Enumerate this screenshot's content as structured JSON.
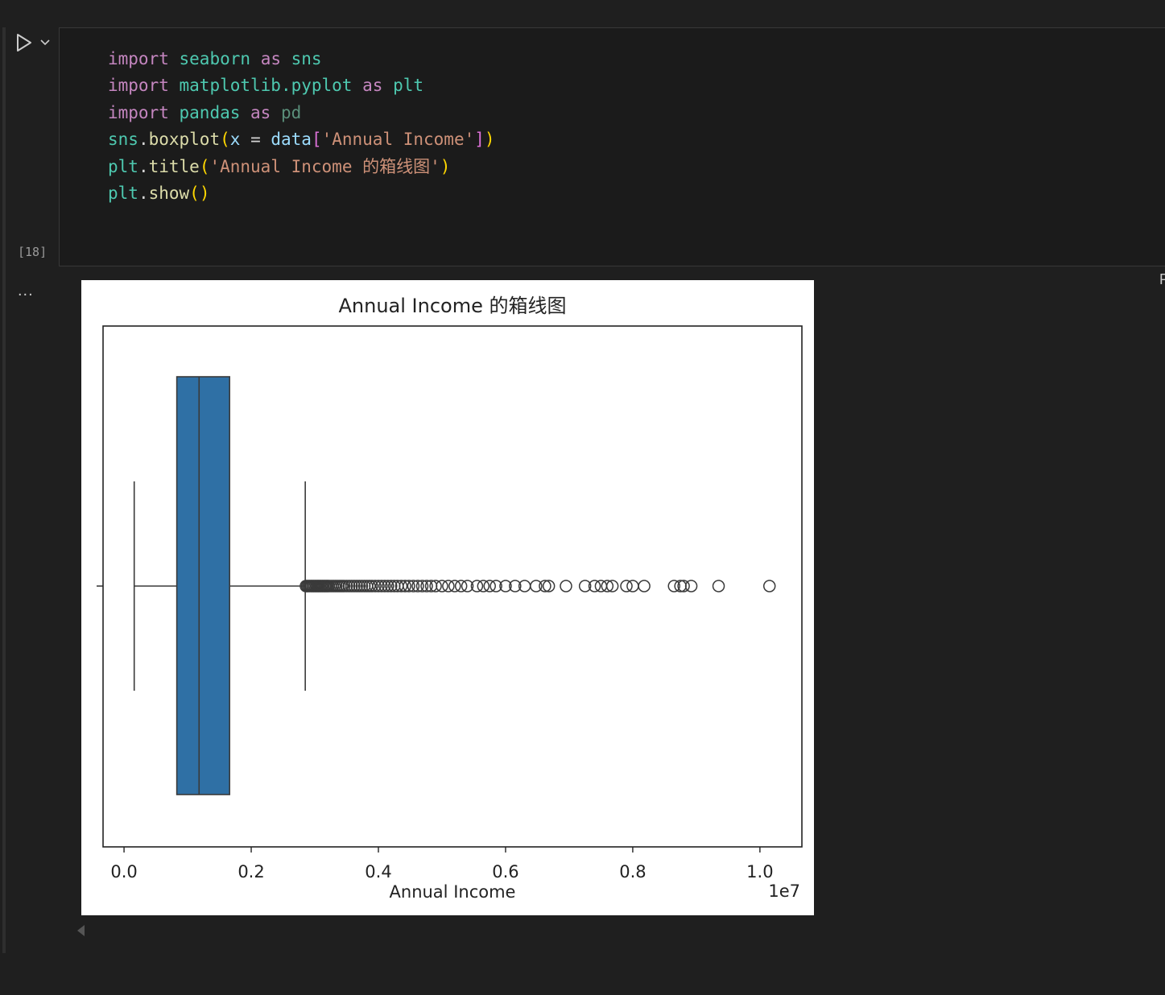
{
  "cell": {
    "execution_count": "[18]",
    "language_label_partial": "P",
    "output_menu_label": "...",
    "code_lines": [
      [
        "import",
        " ",
        "seaborn",
        " ",
        "as",
        " ",
        "sns"
      ],
      [
        "import",
        " ",
        "matplotlib.pyplot",
        " ",
        "as",
        " ",
        "plt"
      ],
      [
        "import",
        " ",
        "pandas",
        " ",
        "as",
        " ",
        "pd"
      ],
      [
        "sns",
        ".",
        "boxplot",
        "(",
        "x",
        " = ",
        "data",
        "[",
        "'Annual Income'",
        "]",
        ")"
      ],
      [
        "plt",
        ".",
        "title",
        "(",
        "'Annual Income 的箱线图'",
        ")"
      ],
      [
        "plt",
        ".",
        "show",
        "(",
        ")"
      ]
    ],
    "icons": {
      "run": "run-cell-icon",
      "chevron": "chevron-down-icon",
      "scroll": "scroll-left-icon"
    }
  },
  "chart_data": {
    "type": "box",
    "title": "Annual Income 的箱线图",
    "xlabel": "Annual Income",
    "ylabel": "",
    "x_offset_label": "1e7",
    "xlim": [
      -0.033,
      1.066
    ],
    "xticks": [
      0.0,
      0.2,
      0.4,
      0.6,
      0.8,
      1.0
    ],
    "xtick_labels": [
      "0.0",
      "0.2",
      "0.4",
      "0.6",
      "0.8",
      "1.0"
    ],
    "scale_factor": 10000000,
    "box": {
      "whisker_low": 0.016,
      "q1": 0.083,
      "median": 0.118,
      "q3": 0.166,
      "whisker_high": 0.285,
      "color": "#2f70a5"
    },
    "outliers": [
      0.286,
      0.288,
      0.29,
      0.292,
      0.294,
      0.296,
      0.298,
      0.3,
      0.302,
      0.304,
      0.306,
      0.308,
      0.31,
      0.312,
      0.314,
      0.316,
      0.318,
      0.32,
      0.322,
      0.325,
      0.328,
      0.331,
      0.334,
      0.337,
      0.34,
      0.343,
      0.346,
      0.35,
      0.354,
      0.358,
      0.362,
      0.366,
      0.37,
      0.374,
      0.378,
      0.382,
      0.386,
      0.39,
      0.395,
      0.4,
      0.405,
      0.41,
      0.415,
      0.42,
      0.425,
      0.43,
      0.436,
      0.442,
      0.448,
      0.455,
      0.462,
      0.469,
      0.476,
      0.483,
      0.49,
      0.5,
      0.51,
      0.52,
      0.53,
      0.54,
      0.555,
      0.565,
      0.575,
      0.585,
      0.6,
      0.615,
      0.63,
      0.648,
      0.662,
      0.668,
      0.695,
      0.725,
      0.74,
      0.75,
      0.76,
      0.768,
      0.79,
      0.8,
      0.818,
      0.865,
      0.875,
      0.88,
      0.892,
      0.935,
      1.015
    ],
    "grid": false,
    "legend": "none"
  }
}
